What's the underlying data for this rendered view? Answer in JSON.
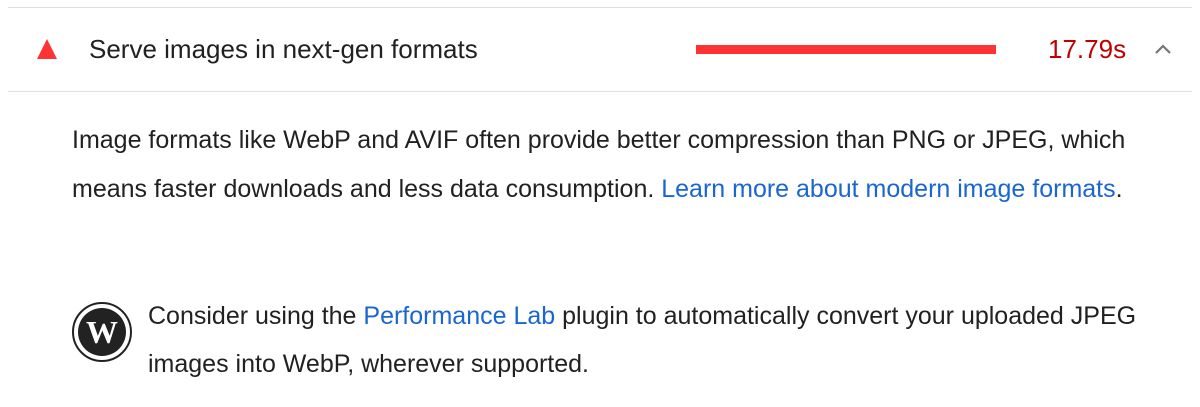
{
  "audit": {
    "title": "Serve images in next-gen formats",
    "savings_display": "17.79s",
    "savings_fraction": 1.0,
    "status_icon": "fail-triangle-icon",
    "toggle_icon": "chevron-up-icon",
    "colors": {
      "fail": "#ff3333",
      "savings_text": "#c00000",
      "link": "#1a66d1"
    }
  },
  "description": {
    "text_before": "Image formats like WebP and AVIF often provide better compression than PNG or JPEG, which means faster downloads and less data consumption. ",
    "link_text": "Learn more about modern image formats",
    "text_after": "."
  },
  "stack_pack": {
    "icon": "wordpress-icon",
    "text_before": "Consider using the ",
    "link_text": "Performance Lab",
    "text_after": " plugin to automatically convert your uploaded JPEG images into WebP, wherever supported."
  }
}
